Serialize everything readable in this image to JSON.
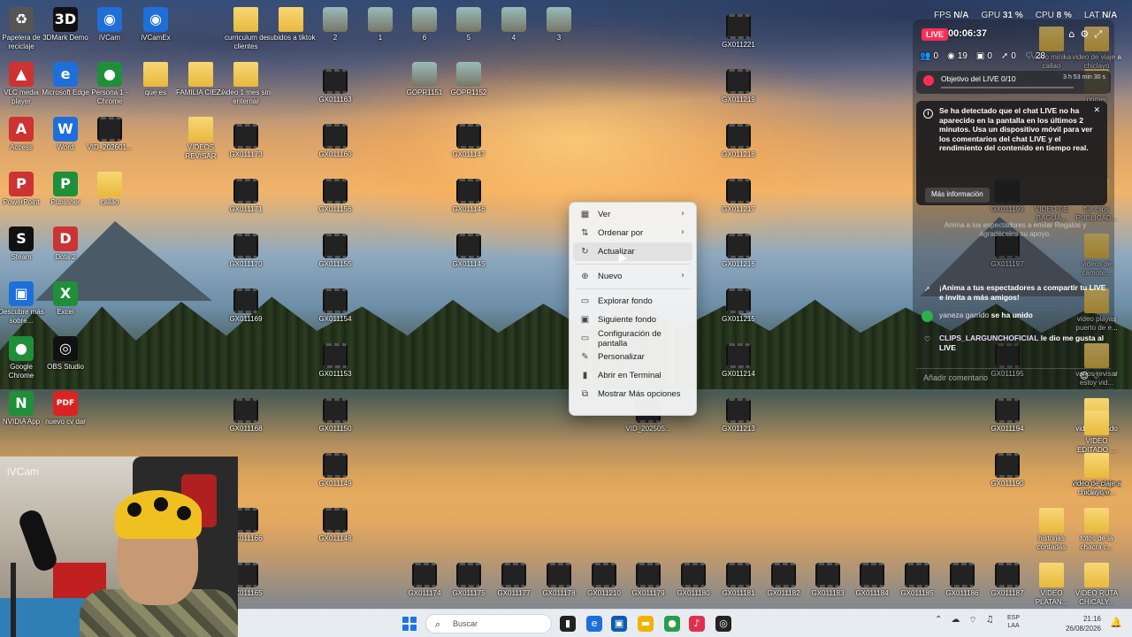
{
  "perf": {
    "fps_label": "FPS",
    "fps": "N/A",
    "gpu_label": "GPU",
    "gpu": "31 %",
    "cpu_label": "CPU",
    "cpu": "8 %",
    "lat_label": "LAT",
    "lat": "N/A"
  },
  "desktop_icons": [
    {
      "label": "Papelera de reciclaje",
      "kind": "app-gray",
      "glyph": "♻"
    },
    {
      "label": "3DMark Demo",
      "kind": "app-dark",
      "glyph": "3D"
    },
    {
      "label": "iVCam",
      "kind": "app-blue",
      "glyph": "◉"
    },
    {
      "label": "iVCamEx",
      "kind": "app-blue",
      "glyph": "◉"
    },
    {
      "label": "curriculum de clientes",
      "kind": "folder",
      "glyph": ""
    },
    {
      "label": "subidos a tiktok",
      "kind": "folder",
      "glyph": ""
    },
    {
      "label": "2",
      "kind": "photo",
      "glyph": ""
    },
    {
      "label": "1",
      "kind": "photo",
      "glyph": ""
    },
    {
      "label": "6",
      "kind": "photo",
      "glyph": ""
    },
    {
      "label": "5",
      "kind": "photo",
      "glyph": ""
    },
    {
      "label": "4",
      "kind": "photo",
      "glyph": ""
    },
    {
      "label": "3",
      "kind": "photo",
      "glyph": ""
    },
    {
      "label": "GX011221",
      "kind": "video",
      "glyph": ""
    },
    {
      "label": "VLC media player",
      "kind": "app-red",
      "glyph": "▲"
    },
    {
      "label": "Microsoft Edge",
      "kind": "app-blue",
      "glyph": "e"
    },
    {
      "label": "Persona 1 - Chrome",
      "kind": "app-green",
      "glyph": "●"
    },
    {
      "label": "que es",
      "kind": "folder",
      "glyph": ""
    },
    {
      "label": "FAMILIA CIEZA",
      "kind": "folder",
      "glyph": ""
    },
    {
      "label": "video 1 mes sin enternar",
      "kind": "folder",
      "glyph": ""
    },
    {
      "label": "GX011163",
      "kind": "video",
      "glyph": ""
    },
    {
      "label": "GOPR1151",
      "kind": "photo",
      "glyph": ""
    },
    {
      "label": "GOPR1152",
      "kind": "photo",
      "glyph": ""
    },
    {
      "label": "GX011219",
      "kind": "video",
      "glyph": ""
    },
    {
      "label": "Access",
      "kind": "app-red",
      "glyph": "A"
    },
    {
      "label": "Word",
      "kind": "app-blue",
      "glyph": "W"
    },
    {
      "label": "VID_202601...",
      "kind": "video",
      "glyph": ""
    },
    {
      "label": "VIDEOS REVISAR",
      "kind": "folder",
      "glyph": ""
    },
    {
      "label": "GX011173",
      "kind": "video",
      "glyph": ""
    },
    {
      "label": "GX011160",
      "kind": "video",
      "glyph": ""
    },
    {
      "label": "GX011147",
      "kind": "video",
      "glyph": ""
    },
    {
      "label": "GX011218",
      "kind": "video",
      "glyph": ""
    },
    {
      "label": "PowerPoint",
      "kind": "app-red",
      "glyph": "P"
    },
    {
      "label": "Publisher",
      "kind": "app-green",
      "glyph": "P"
    },
    {
      "label": "callao",
      "kind": "folder",
      "glyph": ""
    },
    {
      "label": "GX011171",
      "kind": "video",
      "glyph": ""
    },
    {
      "label": "GX011156",
      "kind": "video",
      "glyph": ""
    },
    {
      "label": "GX011146",
      "kind": "video",
      "glyph": ""
    },
    {
      "label": "GX011217",
      "kind": "video",
      "glyph": ""
    },
    {
      "label": "Steam",
      "kind": "app-dark",
      "glyph": "S"
    },
    {
      "label": "Dota 2",
      "kind": "app-red",
      "glyph": "D"
    },
    {
      "label": "GX011170",
      "kind": "video",
      "glyph": ""
    },
    {
      "label": "GX011155",
      "kind": "video",
      "glyph": ""
    },
    {
      "label": "GX011145",
      "kind": "video",
      "glyph": ""
    },
    {
      "label": "GX011216",
      "kind": "video",
      "glyph": ""
    },
    {
      "label": "Descubre más sobre...",
      "kind": "app-blue",
      "glyph": "▣"
    },
    {
      "label": "Excel",
      "kind": "app-green",
      "glyph": "X"
    },
    {
      "label": "GX011169",
      "kind": "video",
      "glyph": ""
    },
    {
      "label": "GX011154",
      "kind": "video",
      "glyph": ""
    },
    {
      "label": "GX011215",
      "kind": "video",
      "glyph": ""
    },
    {
      "label": "Google Chrome",
      "kind": "app-green",
      "glyph": "●"
    },
    {
      "label": "OBS Studio",
      "kind": "app-dark",
      "glyph": "◎"
    },
    {
      "label": "GX011153",
      "kind": "video",
      "glyph": ""
    },
    {
      "label": "GX011214",
      "kind": "video",
      "glyph": ""
    },
    {
      "label": "NVIDIA App",
      "kind": "app-green",
      "glyph": "N"
    },
    {
      "label": "nuevo cv dar",
      "kind": "pdf",
      "glyph": "PDF"
    },
    {
      "label": "GX011168",
      "kind": "video",
      "glyph": ""
    },
    {
      "label": "GX011150",
      "kind": "video",
      "glyph": ""
    },
    {
      "label": "VID_202505...",
      "kind": "video",
      "glyph": ""
    },
    {
      "label": "GX011213",
      "kind": "video",
      "glyph": ""
    },
    {
      "label": "GX011149",
      "kind": "video",
      "glyph": ""
    },
    {
      "label": "GX011166",
      "kind": "video",
      "glyph": ""
    },
    {
      "label": "GX011148",
      "kind": "video",
      "glyph": ""
    },
    {
      "label": "GX011165",
      "kind": "video",
      "glyph": ""
    },
    {
      "label": "GX011174",
      "kind": "video",
      "glyph": ""
    },
    {
      "label": "GX011175",
      "kind": "video",
      "glyph": ""
    },
    {
      "label": "GX011177",
      "kind": "video",
      "glyph": ""
    },
    {
      "label": "GX011178",
      "kind": "video",
      "glyph": ""
    },
    {
      "label": "GX011210",
      "kind": "video",
      "glyph": ""
    },
    {
      "label": "GX011179",
      "kind": "video",
      "glyph": ""
    },
    {
      "label": "GX011180",
      "kind": "video",
      "glyph": ""
    },
    {
      "label": "GX011181",
      "kind": "video",
      "glyph": ""
    },
    {
      "label": "GX011182",
      "kind": "video",
      "glyph": ""
    },
    {
      "label": "GX011183",
      "kind": "video",
      "glyph": ""
    },
    {
      "label": "GX011184",
      "kind": "video",
      "glyph": ""
    },
    {
      "label": "GX011185",
      "kind": "video",
      "glyph": ""
    },
    {
      "label": "GX011186",
      "kind": "video",
      "glyph": ""
    },
    {
      "label": "GX011187",
      "kind": "video",
      "glyph": ""
    },
    {
      "label": "VIDEO PLATAN...",
      "kind": "folder",
      "glyph": ""
    },
    {
      "label": "VIDEO RUTA CHICALY...",
      "kind": "folder",
      "glyph": ""
    },
    {
      "label": "video editado",
      "kind": "folder",
      "glyph": ""
    },
    {
      "label": "video de ciaje a chiclayo",
      "kind": "folder",
      "glyph": ""
    },
    {
      "label": "GX011199",
      "kind": "video",
      "glyph": ""
    },
    {
      "label": "VIDEO DE BAGUA...",
      "kind": "folder",
      "glyph": ""
    },
    {
      "label": "full clips PUBLICAD...",
      "kind": "folder",
      "glyph": ""
    },
    {
      "label": "GX011197",
      "kind": "video",
      "glyph": ""
    },
    {
      "label": "videos de camote...",
      "kind": "folder",
      "glyph": ""
    },
    {
      "label": "video playas puerto de e...",
      "kind": "folder",
      "glyph": ""
    },
    {
      "label": "GX011195",
      "kind": "video",
      "glyph": ""
    },
    {
      "label": "varios revisar estoy vid...",
      "kind": "folder",
      "glyph": ""
    },
    {
      "label": "GX011194",
      "kind": "video",
      "glyph": ""
    },
    {
      "label": "VIDEO EDITADO ...",
      "kind": "folder",
      "glyph": ""
    },
    {
      "label": "GX011190",
      "kind": "video",
      "glyph": ""
    },
    {
      "label": "video de ciaje a chiclayo e...",
      "kind": "folder",
      "glyph": ""
    },
    {
      "label": "historias contadas",
      "kind": "folder",
      "glyph": ""
    },
    {
      "label": "fotos de la chacra c...",
      "kind": "folder",
      "glyph": ""
    },
    {
      "label": "video minika callao",
      "kind": "folder",
      "glyph": ""
    },
    {
      "label": "video de viaje a chiclayo",
      "kind": "folder",
      "glyph": ""
    },
    {
      "label": "primer",
      "kind": "folder",
      "glyph": ""
    }
  ],
  "webcam": {
    "label": "iVCam"
  },
  "context_menu": {
    "items": [
      {
        "label": "Ver",
        "icon": "grid-icon",
        "glyph": "▦",
        "submenu": true
      },
      {
        "label": "Ordenar por",
        "icon": "sort-icon",
        "glyph": "⇅",
        "submenu": true
      },
      {
        "label": "Actualizar",
        "icon": "refresh-icon",
        "glyph": "↻",
        "submenu": false
      },
      {
        "label": "Nuevo",
        "icon": "new-icon",
        "glyph": "⊕",
        "submenu": true
      },
      {
        "label": "Explorar fondo",
        "icon": "explore-icon",
        "glyph": "▭",
        "submenu": false
      },
      {
        "label": "Siguiente fondo",
        "icon": "next-background-icon",
        "glyph": "▣",
        "submenu": false
      },
      {
        "label": "Configuración de pantalla",
        "icon": "display-icon",
        "glyph": "▭",
        "submenu": false
      },
      {
        "label": "Personalizar",
        "icon": "brush-icon",
        "glyph": "✎",
        "submenu": false
      },
      {
        "label": "Abrir en Terminal",
        "icon": "terminal-icon",
        "glyph": "▮",
        "submenu": false
      },
      {
        "label": "Mostrar Más opciones",
        "icon": "more-options-icon",
        "glyph": "⧉",
        "submenu": false
      }
    ],
    "chevron": "›"
  },
  "live": {
    "badge": "LIVE",
    "timer": "00:06:37",
    "counters": [
      {
        "icon": "people-icon",
        "glyph": "👥",
        "value": "0"
      },
      {
        "icon": "eye-icon",
        "glyph": "◉",
        "value": "19"
      },
      {
        "icon": "gift-icon",
        "glyph": "▣",
        "value": "0"
      },
      {
        "icon": "share-icon",
        "glyph": "➚",
        "value": "0"
      },
      {
        "icon": "heart-icon",
        "glyph": "♡",
        "value": "28"
      }
    ],
    "goal_label": "Objetivo del LIVE 0/10",
    "goal_time": "3 h 53 min 30 s",
    "notice_text": "Se ha detectado que el chat LIVE no ha aparecido en la pantalla en los últimos 2 minutos. Usa un dispositivo móvil para ver los comentarios del chat LIVE y el rendimiento del contenido en tiempo real.",
    "notice_button": "Más información",
    "faded_invite": "Anima a los espectadores a enviar Regalos y agradéceles su apoyo.",
    "msg_share": "¡Anima a tus espectadores a compartir tu LIVE e invita a más amigos!",
    "msg_join_user": "yaneza garrido",
    "msg_join_text": "se ha unido",
    "msg_like_user": "CLIPS_LARGUNCHOFICIAL",
    "msg_like_text": "le dio me gusta al LIVE",
    "comment_placeholder": "Añadir comentario"
  },
  "taskbar": {
    "search_placeholder": "Buscar",
    "lang_top": "ESP",
    "lang_bottom": "LAA",
    "time": "21:16",
    "date": "26/08/2026"
  },
  "colors": {
    "accent": "#1a73e8",
    "live_red": "#ff2d55",
    "folder": "#f8d775"
  }
}
